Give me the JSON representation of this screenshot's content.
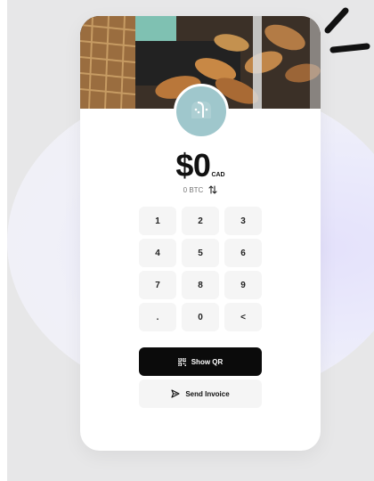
{
  "payment": {
    "amount": "$0",
    "currency": "CAD",
    "secondary_amount": "0 BTC"
  },
  "keypad": {
    "keys": [
      "1",
      "2",
      "3",
      "4",
      "5",
      "6",
      "7",
      "8",
      "9",
      ".",
      "0",
      "<"
    ]
  },
  "actions": {
    "show_qr_label": "Show QR",
    "send_invoice_label": "Send Invoice"
  },
  "icons": {
    "logo": "bread-loaf-icon",
    "swap": "swap-vertical-icon",
    "qr": "qr-code-icon",
    "send": "send-icon",
    "backspace": "chevron-left-icon"
  },
  "colors": {
    "primary_button": "#0b0b0b",
    "key_background": "#f5f5f5",
    "logo_background": "#9fc7cc",
    "blob": "#ebebfb"
  }
}
